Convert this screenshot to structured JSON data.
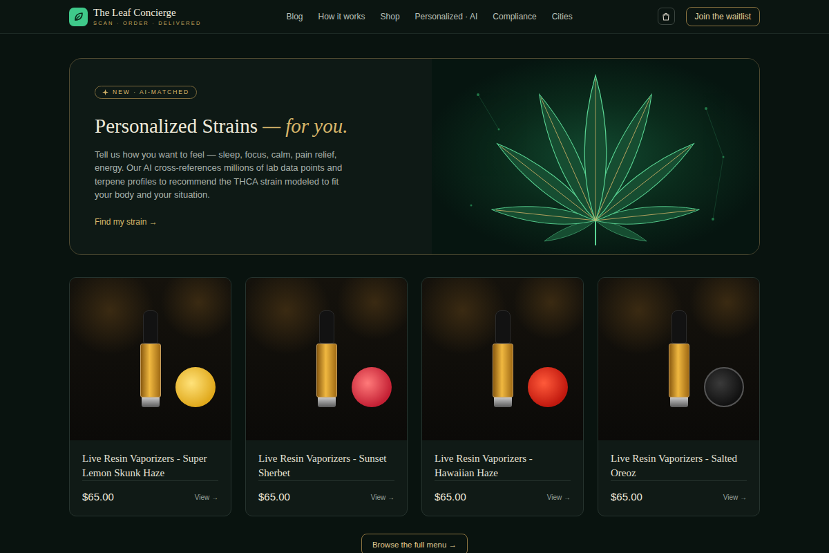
{
  "brand": {
    "name": "The Leaf Concierge",
    "tagline": "SCAN · ORDER · DELIVERED"
  },
  "nav": [
    {
      "label": "Blog"
    },
    {
      "label": "How it works"
    },
    {
      "label": "Shop"
    },
    {
      "label": "Personalized · AI"
    },
    {
      "label": "Compliance"
    },
    {
      "label": "Cities"
    }
  ],
  "waitlist_button": "Join the waitlist",
  "hero": {
    "badge": "NEW · AI-MATCHED",
    "title": "Personalized Strains",
    "title_accent": "— for you.",
    "description": "Tell us how you want to feel — sleep, focus, calm, pain relief, energy. Our AI cross-references millions of lab data points and terpene profiles to recommend the THCA strain modeled to fit your body and your situation.",
    "cta": "Find my strain →"
  },
  "products": [
    {
      "name": "Live Resin Vaporizers - Super Lemon Skunk Haze",
      "price": "$65.00",
      "action": "View →"
    },
    {
      "name": "Live Resin Vaporizers - Sunset Sherbet",
      "price": "$65.00",
      "action": "View →"
    },
    {
      "name": "Live Resin Vaporizers - Hawaiian Haze",
      "price": "$65.00",
      "action": "View →"
    },
    {
      "name": "Live Resin Vaporizers - Salted Oreoz",
      "price": "$65.00",
      "action": "View →"
    }
  ],
  "browse_button": "Browse the full menu →"
}
